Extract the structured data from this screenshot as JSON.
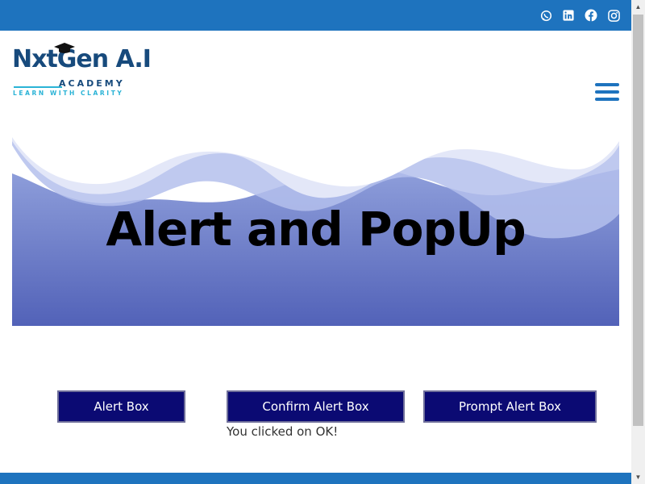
{
  "topbar": {
    "social_icons": [
      "whatsapp-icon",
      "linkedin-icon",
      "facebook-icon",
      "instagram-icon"
    ],
    "color": "#1e73be"
  },
  "logo": {
    "main": "NxtGen A.I",
    "academy": "ACADEMY",
    "tagline": "LEARN WITH CLARITY"
  },
  "menu": {
    "icon": "hamburger-menu-icon"
  },
  "hero": {
    "title": "Alert and PopUp"
  },
  "buttons": {
    "alert_label": "Alert Box",
    "confirm_label": "Confirm Alert Box",
    "prompt_label": "Prompt Alert Box"
  },
  "result_text": "You clicked on OK!",
  "colors": {
    "brand_blue": "#1e73be",
    "button_bg": "#0b0a73",
    "hero_dark": "#5565bb",
    "hero_light": "#dfe4f7"
  }
}
